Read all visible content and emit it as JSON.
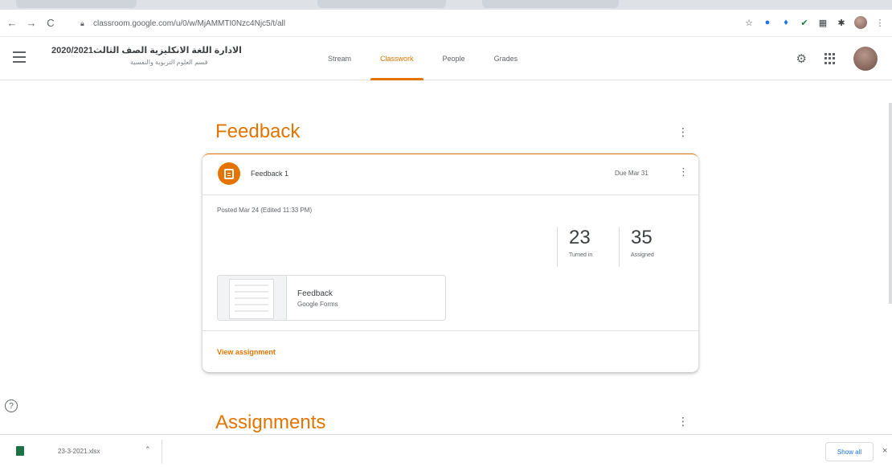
{
  "browser": {
    "url": "classroom.google.com/u/0/w/MjAMMTI0Nzc4Njc5/t/all",
    "nav": {
      "back": "←",
      "forward": "→",
      "reload": "C"
    },
    "extensions": [
      "☆",
      "●",
      "♦",
      "✔",
      "▦",
      "✱"
    ]
  },
  "header": {
    "class_title": "2020/2021الادارة اللغة الانكليزية الصف الثالث",
    "class_subtitle": "قسم العلوم التربوية والنفسية",
    "tabs": [
      "Stream",
      "Classwork",
      "People",
      "Grades"
    ],
    "active_tab": "Classwork"
  },
  "topics": [
    {
      "title": "Feedback"
    },
    {
      "title": "Assignments"
    }
  ],
  "assignment": {
    "title": "Feedback 1",
    "due": "Due Mar 31",
    "posted": "Posted Mar 24 (Edited 11:33 PM)",
    "stats": [
      {
        "value": "23",
        "label": "Turned in"
      },
      {
        "value": "35",
        "label": "Assigned"
      }
    ],
    "attachment": {
      "title": "Feedback",
      "subtitle": "Google Forms"
    },
    "link": "View assignment"
  },
  "help": {
    "glyph": "?"
  },
  "download_bar": {
    "file_name": "23-3-2021.xlsx",
    "show_all": "Show all",
    "close": "×"
  },
  "colors": {
    "accent": "#e37400",
    "text": "#3c4043",
    "muted": "#5f6368"
  }
}
